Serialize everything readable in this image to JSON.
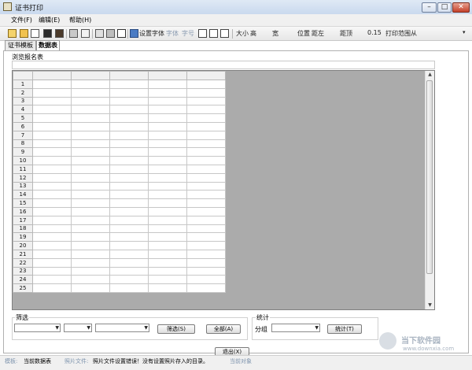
{
  "window": {
    "title": "证书打印",
    "min": "–",
    "max": "□",
    "close": "✕"
  },
  "menu": [
    "文件(F)",
    "编辑(E)",
    "帮助(H)"
  ],
  "toolbar": {
    "icons": [
      "open-folder-icon",
      "folder-icon",
      "new-file-icon",
      "save-icon",
      "pack-icon",
      "print-icon",
      "print-preview-icon",
      "copy-icon",
      "paste-icon",
      "cut-icon"
    ],
    "set_font": "设置字体",
    "font_label": "字体",
    "size_label": "字号",
    "size_dim": "大小",
    "size_val": "高",
    "width": "宽",
    "position": "位置",
    "margin_left": "距左",
    "margin_top": "距顶",
    "num": "0.15",
    "print_range": "打印范围",
    "from": "从"
  },
  "tabs": [
    "证书模板",
    "数据表"
  ],
  "panel": {
    "title": "浏览报名表"
  },
  "grid": {
    "row_numbers": [
      "1",
      "2",
      "3",
      "4",
      "5",
      "6",
      "7",
      "8",
      "9",
      "10",
      "11",
      "12",
      "13",
      "14",
      "15",
      "16",
      "17",
      "18",
      "19",
      "20",
      "21",
      "22",
      "23",
      "24",
      "25"
    ]
  },
  "filter": {
    "title": "筛选",
    "filter_button": "筛选(S)",
    "all_button": "全部(A)"
  },
  "stats": {
    "title": "统计",
    "group_label": "分组",
    "stats_button": "统计(T)"
  },
  "partial_button": "退出(X)",
  "status": {
    "template_label": "模板:",
    "template_value": "当前数据表",
    "photo_label": "照片文件:",
    "photo_value": "照片文件设置错误！没有设置照片存入的目录。",
    "current_label": "当前对象"
  },
  "watermark": {
    "brand": "当下软件园",
    "url": "www.downxia.com"
  }
}
